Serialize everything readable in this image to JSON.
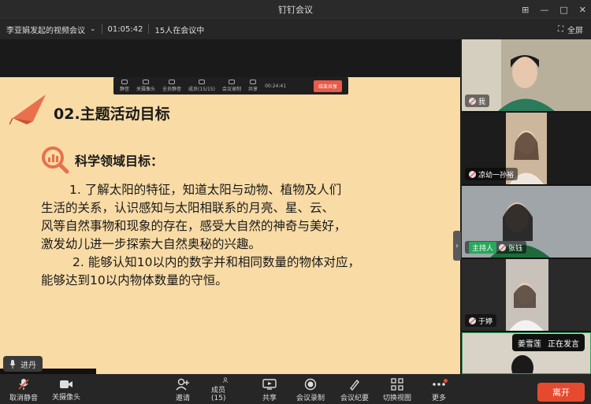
{
  "window": {
    "title": "钉钉会议"
  },
  "info": {
    "meeting_name": "李亚娟发起的视频会议",
    "elapsed": "01:05:42",
    "attendees": "15人在会议中",
    "fullscreen_label": "全屏"
  },
  "share_toolbar": {
    "items": [
      "静音",
      "关摄像头",
      "全员静音",
      "成员(15/15)",
      "会议录制",
      "共享"
    ],
    "time": "00:24:41",
    "stop_label": "结束共享"
  },
  "slide": {
    "title": "02.主题活动目标",
    "section_title": "科学领域目标：",
    "paragraph1_lines": [
      "1. 了解太阳的特征，知道太阳与动物、植物及人们",
      "生活的关系，认识感知与太阳相联系的月亮、星、云、",
      "风等自然事物和现象的存在，感受大自然的神奇与美好，",
      "激发幼儿进一步探索大自然奥秘的兴趣。"
    ],
    "paragraph2_lines": [
      "2. 能够认知10以内的数字并和相同数量的物体对应，",
      "能够达到10以内物体数量的守恒。"
    ]
  },
  "speaker_chip": {
    "name": "进丹"
  },
  "participants": [
    {
      "name": "我",
      "host": false
    },
    {
      "name": "凉幼一孙裕",
      "host": false
    },
    {
      "name": "张钰",
      "host": true,
      "host_label": "主持人"
    },
    {
      "name": "于婷",
      "host": false
    },
    {
      "name": "",
      "host": false
    }
  ],
  "speaking": {
    "name": "姜雪莲",
    "status": "正在发言"
  },
  "bottom": {
    "mute_label": "取消静音",
    "camera_label": "关摄像头",
    "invite_label": "邀请",
    "members_label": "成员(15)",
    "share_label": "共享",
    "record_label": "会议录制",
    "minutes_label": "会议纪要",
    "view_label": "切换视图",
    "more_label": "更多",
    "leave_label": "离开"
  },
  "colors": {
    "accent": "#e64a2e",
    "slide_bg": "#f8dba5",
    "host_green": "#27a85a"
  }
}
